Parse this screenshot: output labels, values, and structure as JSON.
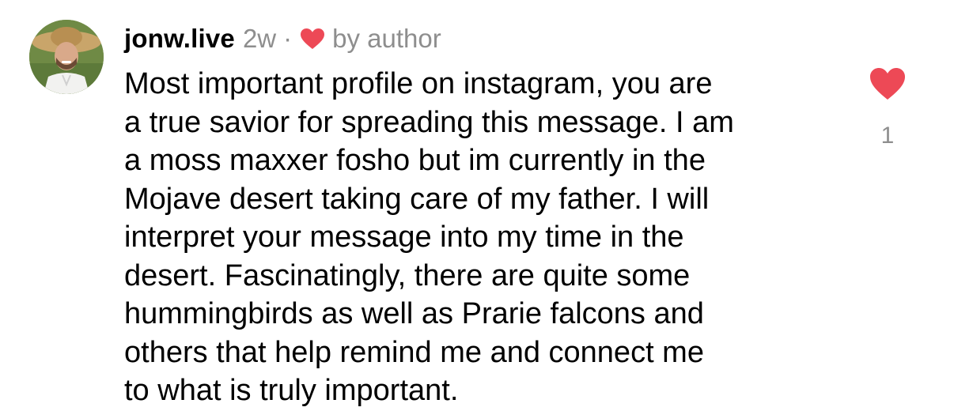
{
  "comment": {
    "username": "jonw.live",
    "time_ago": "2w",
    "separator": "·",
    "author_like_label": "by author",
    "text_lines": [
      "Most important profile on instagram, you are",
      "a true savior for spreading this message. I am",
      "a moss maxxer fosho but im currently in the",
      "Mojave desert taking care of my father. I will",
      "interpret your message into my time in the",
      "desert. Fascinatingly, there are quite some",
      "hummingbirds as well as Prarie falcons and",
      "others that help remind me and connect me",
      "to what is truly important."
    ],
    "like_count": "1",
    "like_icon": "heart-filled-icon",
    "author_like_icon": "heart-filled-icon"
  },
  "colors": {
    "heart": "#ed4956",
    "secondary_text": "#8e8e8e",
    "primary_text": "#000000"
  }
}
